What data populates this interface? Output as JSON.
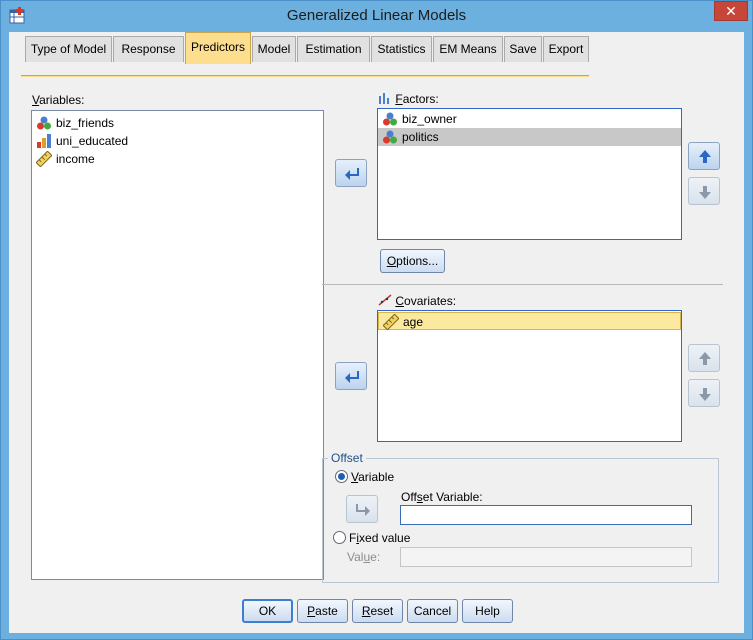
{
  "window": {
    "title": "Generalized Linear Models",
    "close_label": "✕"
  },
  "tabs": [
    {
      "label": "Type of Model"
    },
    {
      "label": "Response"
    },
    {
      "label": "Predictors",
      "active": true
    },
    {
      "label": "Model"
    },
    {
      "label": "Estimation"
    },
    {
      "label": "Statistics"
    },
    {
      "label": "EM Means"
    },
    {
      "label": "Save"
    },
    {
      "label": "Export"
    }
  ],
  "variables": {
    "label_underlined": "V",
    "label_rest": "ariables:",
    "items": [
      {
        "name": "biz_friends",
        "icon": "nominal-icon"
      },
      {
        "name": "uni_educated",
        "icon": "ordinal-icon"
      },
      {
        "name": "income",
        "icon": "scale-icon"
      }
    ]
  },
  "factors": {
    "label_underlined": "F",
    "label_rest": "actors:",
    "items": [
      {
        "name": "biz_owner",
        "icon": "nominal-icon"
      },
      {
        "name": "politics",
        "icon": "nominal-icon",
        "selected": true
      }
    ],
    "options_label_underlined": "O",
    "options_label_rest": "ptions..."
  },
  "covariates": {
    "label_underlined": "C",
    "label_rest": "ovariates:",
    "items": [
      {
        "name": "age",
        "icon": "scale-icon",
        "selected": true
      }
    ]
  },
  "offset": {
    "group_title": "Offset",
    "variable_radio_underlined": "V",
    "variable_radio_rest": "ariable",
    "variable_selected": true,
    "offset_variable_label_pre": "Off",
    "offset_variable_label_underlined": "s",
    "offset_variable_label_post": "et Variable:",
    "offset_variable_value": "",
    "fixed_radio_pre": "F",
    "fixed_radio_underlined": "i",
    "fixed_radio_post": "xed value",
    "value_label_pre": "Val",
    "value_label_underlined": "u",
    "value_label_post": "e:",
    "value_value": ""
  },
  "footer": {
    "ok": "OK",
    "paste_underlined": "P",
    "paste_rest": "aste",
    "reset_underlined": "R",
    "reset_rest": "eset",
    "cancel": "Cancel",
    "help": "Help"
  },
  "colors": {
    "accent_tab": "#fcde8e",
    "selection_yellow": "#fce9a0",
    "selection_gray": "#c8c8c8",
    "window_frame": "#6cb0e0"
  }
}
